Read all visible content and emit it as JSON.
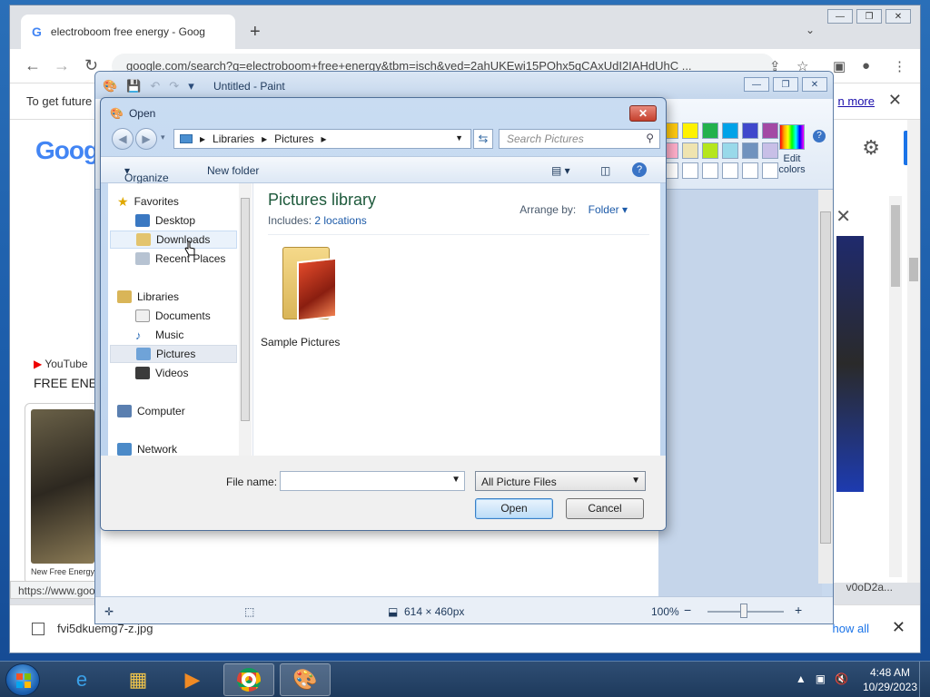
{
  "chrome": {
    "tab_title": "electroboom free energy - Google",
    "url": "google.com/search?q=electroboom+free+energy&tbm=isch&ved=2ahUKEwi15POhx5qCAxUdI2IAHdUhC ...",
    "infobar_text": "To get future",
    "infobar_link": "n more",
    "google_logo": "Goog",
    "yt_label": "YouTube",
    "result_title": "FREE ENE",
    "thumb_caption": "New Free Energy Ge",
    "status_url": "https://www.goo",
    "right_url_fragment": "v0oD2a...",
    "download_file": "fvi5dkuemg7-z.jpg",
    "show_all": "how all"
  },
  "paint": {
    "title": "Untitled - Paint",
    "edit_colors": "Edit colors",
    "size": "614 × 460px",
    "zoom": "100%",
    "zoom_minus": "−",
    "zoom_plus": "+",
    "palette_colors": [
      "#ffc90e",
      "#fff200",
      "#22b14c",
      "#00a2e8",
      "#3f48cc",
      "#a349a4",
      "#ffaec9",
      "#efe4b0",
      "#b5e61d",
      "#99d9ea",
      "#7092be",
      "#c8bfe7",
      "#ffffff",
      "#ffffff",
      "#ffffff",
      "#ffffff",
      "#ffffff",
      "#ffffff"
    ]
  },
  "dialog": {
    "title": "Open",
    "path": [
      "Libraries",
      "Pictures"
    ],
    "search_placeholder": "Search Pictures",
    "organize": "Organize",
    "new_folder": "New folder",
    "nav": {
      "favorites": "Favorites",
      "desktop": "Desktop",
      "downloads": "Downloads",
      "recent_places": "Recent Places",
      "libraries": "Libraries",
      "documents": "Documents",
      "music": "Music",
      "pictures": "Pictures",
      "videos": "Videos",
      "computer": "Computer",
      "network": "Network"
    },
    "library_title": "Pictures library",
    "includes_label": "Includes:",
    "includes_link": "2 locations",
    "arrange_by": "Arrange by:",
    "arrange_value": "Folder",
    "folder_name": "Sample Pictures",
    "file_name_label": "File name:",
    "file_name_value": "",
    "file_type": "All Picture Files",
    "open_button": "Open",
    "cancel_button": "Cancel"
  },
  "taskbar": {
    "time": "4:48 AM",
    "date": "10/29/2023"
  }
}
